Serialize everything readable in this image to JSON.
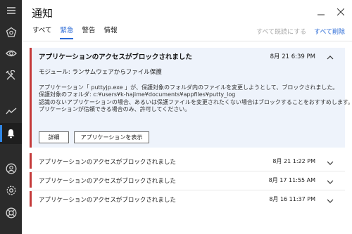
{
  "window": {
    "title": "通知"
  },
  "sidebar": {
    "items": [
      {
        "icon": "menu-icon"
      },
      {
        "icon": "pentagon-icon"
      },
      {
        "icon": "eye-icon"
      },
      {
        "icon": "tools-icon"
      },
      {
        "icon": "chart-icon"
      },
      {
        "icon": "bell-icon",
        "active": true
      },
      {
        "icon": "account-icon"
      },
      {
        "icon": "settings-icon"
      },
      {
        "icon": "help-icon"
      }
    ]
  },
  "tabs": [
    {
      "label": "すべて"
    },
    {
      "label": "緊急",
      "active": true
    },
    {
      "label": "警告"
    },
    {
      "label": "情報"
    }
  ],
  "actions": {
    "mark_all_read": "すべて既読にする",
    "delete_all": "すべて削除"
  },
  "expanded": {
    "title": "アプリケーションのアクセスがブロックされました",
    "time": "8月 21 6:39 PM",
    "module": "モジュール: ランサムウェアからファイル保護",
    "desc": [
      "アプリケーション「 puttyjp.exe 」が、保護対象のフォルダ内のファイルを変更しようとして、ブロックされました。",
      "保護対象のフォルダ: c:¥users¥k-hajime¥documents¥appfiles¥putty_log",
      "認識のないアプリケーションの場合、あるいは保護ファイルを変更されたくない場合はブロックすることをおすすめします。ア",
      "プリケーションが信頼できる場合のみ、許可してください。"
    ],
    "details_button": "詳細",
    "show_app_button": "アプリケーションを表示"
  },
  "rows": [
    {
      "title": "アプリケーションのアクセスがブロックされました",
      "time": "8月 21 1:22 PM"
    },
    {
      "title": "アプリケーションのアクセスがブロックされました",
      "time": "8月 17 11:55 AM"
    },
    {
      "title": "アプリケーションのアクセスがブロックされました",
      "time": "8月 16 11:37 PM"
    }
  ],
  "colors": {
    "accent": "#2a6ad6",
    "critical": "#c43a3a",
    "rail": "#2b2b2b",
    "card_bg": "#eef3fb"
  }
}
